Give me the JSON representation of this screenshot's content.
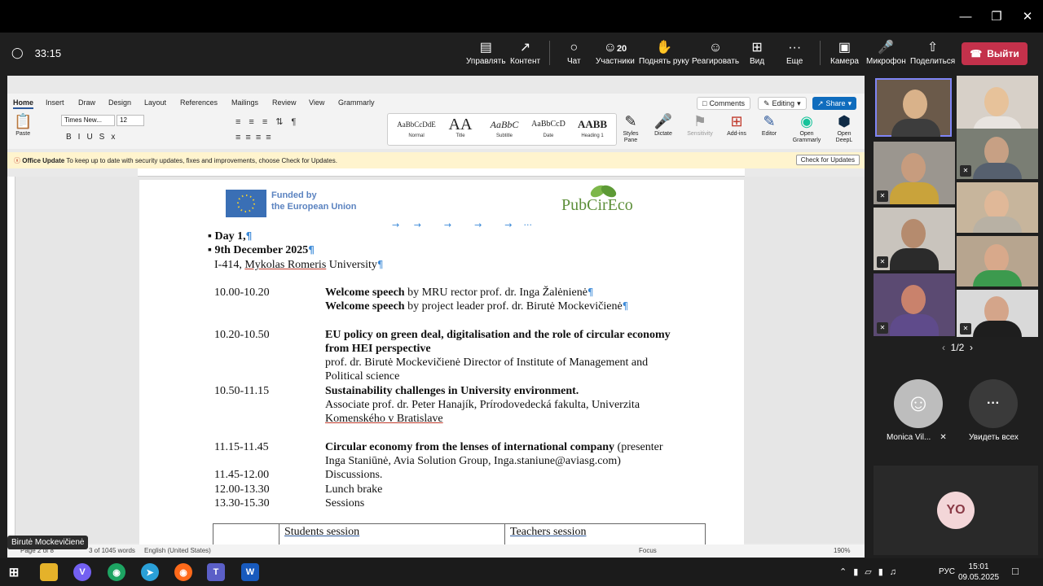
{
  "meeting": {
    "timer": "33:15",
    "toolbar": [
      {
        "id": "manage",
        "label": "Управлять",
        "icon": "manage-icon"
      },
      {
        "id": "content",
        "label": "Контент",
        "icon": "share-content-icon"
      },
      {
        "id": "chat",
        "label": "Чат",
        "icon": "chat-icon"
      },
      {
        "id": "people",
        "label": "Участники",
        "icon": "people-icon",
        "count": "20"
      },
      {
        "id": "raise",
        "label": "Поднять руку",
        "icon": "hand-icon"
      },
      {
        "id": "react",
        "label": "Реагировать",
        "icon": "smile-icon"
      },
      {
        "id": "view",
        "label": "Вид",
        "icon": "grid-icon"
      },
      {
        "id": "more",
        "label": "Еще",
        "icon": "more-icon"
      },
      {
        "id": "camera",
        "label": "Камера",
        "icon": "camera-off-icon"
      },
      {
        "id": "mic",
        "label": "Микрофон",
        "icon": "mic-off-icon"
      },
      {
        "id": "share",
        "label": "Поделиться",
        "icon": "share-icon"
      }
    ],
    "leave_label": "Выйти",
    "presenter_name": "Birutė Mockevičienė",
    "pager": "1/2",
    "participant_name": "Monica Vil...",
    "see_all": "Увидеть всех",
    "yo_initials": "YO"
  },
  "word": {
    "tabs": [
      "Home",
      "Insert",
      "Draw",
      "Design",
      "Layout",
      "References",
      "Mailings",
      "Review",
      "View",
      "Grammarly"
    ],
    "comments_label": "Comments",
    "editing_label": "Editing",
    "share_label": "Share",
    "font_name": "Times New...",
    "font_size": "12",
    "paste_label": "Paste",
    "styles": [
      {
        "sample": "AaBbCcDdE",
        "label": "Normal"
      },
      {
        "sample": "AA",
        "label": "Title"
      },
      {
        "sample": "AaBbC",
        "label": "Subtitle"
      },
      {
        "sample": "AaBbCcD",
        "label": "Date"
      },
      {
        "sample": "AABB",
        "label": "Heading 1"
      }
    ],
    "tools": [
      "Styles Pane",
      "Dictate",
      "Sensitivity",
      "Add-ins",
      "Editor",
      "Open Grammarly",
      "Open DeepL"
    ],
    "notify_title": "Office Update",
    "notify_text": "To keep up to date with security updates, fixes and improvements, choose Check for Updates.",
    "notify_button": "Check for Updates",
    "status": {
      "page": "Page 2 of 8",
      "words": "3 of 1045 words",
      "language": "English (United States)",
      "focus": "Focus",
      "zoom": "190%"
    }
  },
  "document": {
    "eu_text_1": "Funded by",
    "eu_text_2": "the European Union",
    "logo": "PubCirEco",
    "day": "Day 1,",
    "date": "9th December 2025",
    "venue_a": "I-414, ",
    "venue_b": "Mykolas Romeris",
    "venue_c": " University",
    "rows": [
      {
        "time": "10.00-10.20",
        "title": "Welcome speech",
        "rest": " by MRU rector prof. dr. Inga Žalėnienė"
      },
      {
        "time": "",
        "title": "Welcome speech",
        "rest": " by project leader prof. dr. Birutė Mockevičienė"
      },
      {
        "time": "10.20-10.50",
        "title": "EU policy on green deal, digitalisation and the role of circular economy",
        "title2": "from HEI perspective",
        "rest": "prof. dr. Birutė Mockevičienė Director of Institute of Management and",
        "rest2": "Political science"
      },
      {
        "time": "10.50-11.15",
        "title": "Sustainability challenges in University environment.",
        "rest": "Associate prof. dr. Peter Hanajík, Prírodovedecká fakulta, Univerzita",
        "rest2": "Komenského v Bratislave"
      },
      {
        "time": "11.15-11.45",
        "title": "Circular economy from the lenses of international company",
        "rest": " (presenter",
        "rest2": "Inga Staniūnė, Avia Solution Group, Inga.staniune@aviasg.com)"
      },
      {
        "time": "11.45-12.00",
        "title": "",
        "rest": "Discussions."
      },
      {
        "time": "12.00-13.30",
        "title": "",
        "rest": "Lunch brake"
      },
      {
        "time": "13.30-15.30",
        "title": "",
        "rest": "Sessions"
      }
    ],
    "table_col1": "Students session",
    "table_col2": "Teachers session"
  },
  "taskbar": {
    "time": "15:01",
    "date": "09.05.2025",
    "lang": "РУС"
  }
}
